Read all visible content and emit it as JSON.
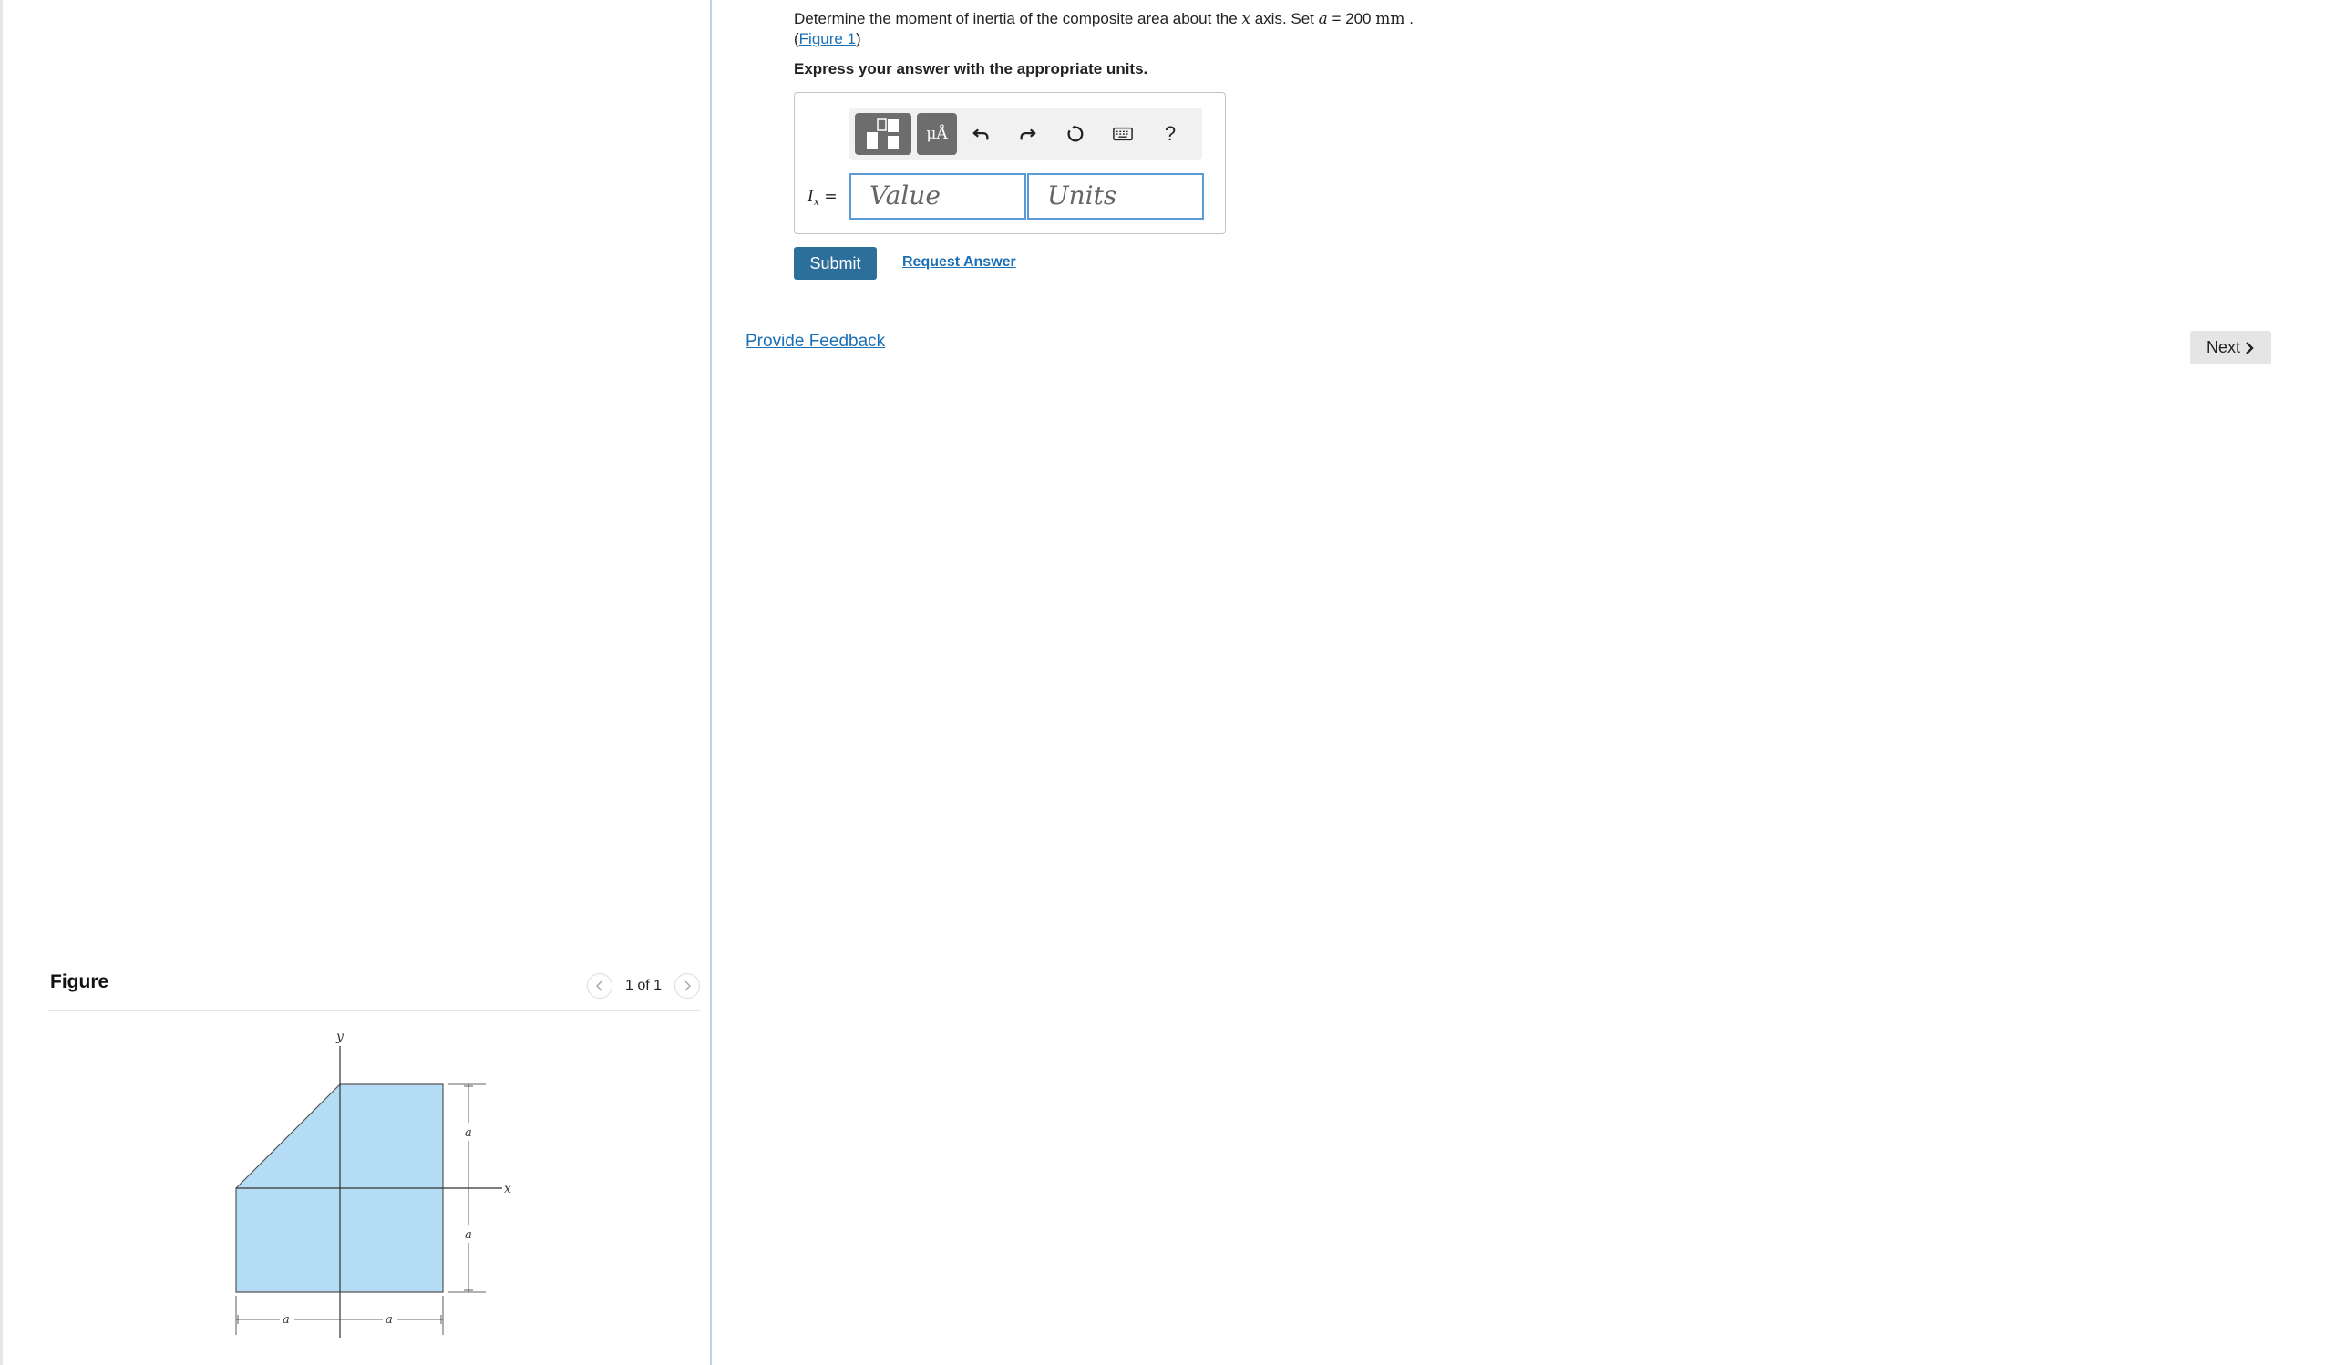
{
  "question": {
    "text_before": "Determine the moment of inertia of the composite area about the ",
    "axis_var": "x",
    "text_mid": " axis. Set ",
    "a_var": "a",
    "a_eq": " = 200 ",
    "a_unit": "mm",
    "a_end": " .",
    "figure_link_open": "(",
    "figure_link": "Figure 1",
    "figure_link_close": ")"
  },
  "instruction": "Express your answer with the appropriate units.",
  "answer": {
    "label_var": "I",
    "label_sub": "x",
    "label_eq": " =",
    "value_placeholder": "Value",
    "units_placeholder": "Units"
  },
  "toolbar": {
    "units_label": "μÅ",
    "help_label": "?",
    "icons": [
      "template-icon",
      "units-icon",
      "undo-icon",
      "redo-icon",
      "reset-icon",
      "keyboard-icon",
      "help-icon"
    ]
  },
  "actions": {
    "submit": "Submit",
    "request_answer": "Request Answer",
    "provide_feedback": "Provide Feedback",
    "next": "Next"
  },
  "figure_panel": {
    "title": "Figure",
    "pager_text": "1 of 1",
    "labels": {
      "y_axis": "y",
      "x_axis": "x",
      "dim_a": "a"
    }
  },
  "colors": {
    "link": "#1a6fb5",
    "submit_bg": "#2c6f9b",
    "shape_fill": "#b5dcf5",
    "field_border": "#5a9bd4"
  }
}
